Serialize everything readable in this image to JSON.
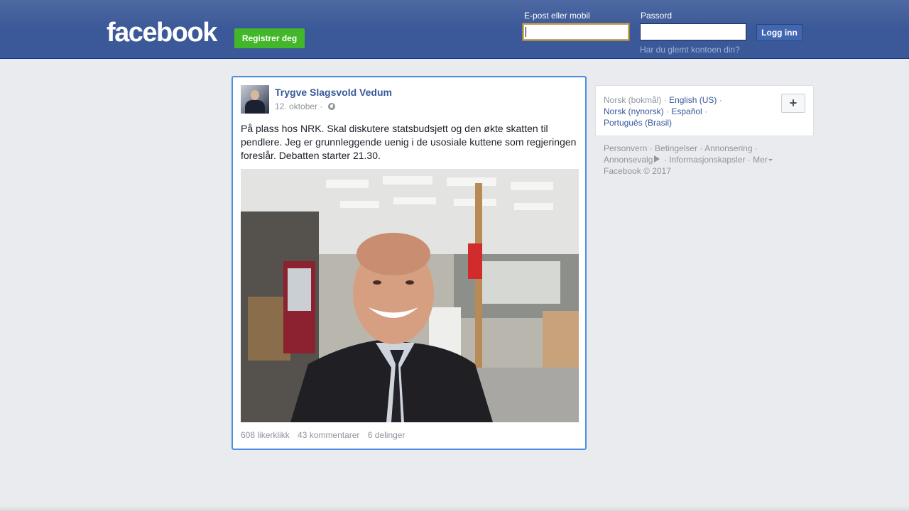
{
  "header": {
    "logo": "facebook",
    "register_label": "Registrer deg",
    "email_label": "E-post eller mobil",
    "password_label": "Passord",
    "login_label": "Logg inn",
    "forgot_label": "Har du glemt kontoen din?"
  },
  "post": {
    "author": "Trygve Slagsvold Vedum",
    "date": "12. oktober",
    "separator": "·",
    "text": "På plass hos NRK. Skal diskutere statsbudsjett og den økte skatten til pendlere. Jeg er grunnleggende uenig i de usosiale kuttene som regjeringen foreslår. Debatten starter 21.30.",
    "likes": "608 likerklikk",
    "comments": "43 kommentarer",
    "shares": "6 delinger"
  },
  "languages": {
    "current": "Norsk (bokmål)",
    "items": [
      "English (US)",
      "Norsk (nynorsk)",
      "Español",
      "Português (Brasil)"
    ],
    "more_symbol": "+"
  },
  "footer": {
    "links": [
      "Personvern",
      "Betingelser",
      "Annonsering",
      "Annonsevalg",
      "Informasjonskapsler",
      "Mer"
    ],
    "copyright": "Facebook © 2017"
  }
}
